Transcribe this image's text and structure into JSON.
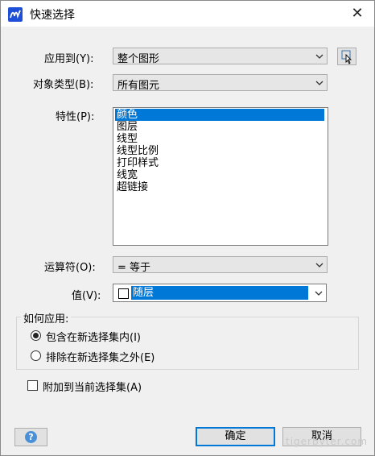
{
  "window": {
    "title": "快速选择",
    "close": "✕"
  },
  "apply_to": {
    "label": "应用到(Y):",
    "value": "整个图形"
  },
  "object_type": {
    "label": "对象类型(B):",
    "value": "所有图元"
  },
  "properties": {
    "label": "特性(P):",
    "items": [
      "颜色",
      "图层",
      "线型",
      "线型比例",
      "打印样式",
      "线宽",
      "超链接"
    ],
    "selected_index": 0
  },
  "operator": {
    "label": "运算符(O):",
    "value": "=  等于"
  },
  "value": {
    "label": "值(V):",
    "value": "随层"
  },
  "how_to_apply": {
    "label": "如何应用:",
    "options": [
      {
        "label": "包含在新选择集内(I)",
        "checked": true
      },
      {
        "label": "排除在新选择集之外(E)",
        "checked": false
      }
    ]
  },
  "append": {
    "label": "附加到当前选择集(A)",
    "checked": false
  },
  "buttons": {
    "ok": "确定",
    "cancel": "取消",
    "help": "?"
  },
  "watermark": "tigerbyter.com"
}
